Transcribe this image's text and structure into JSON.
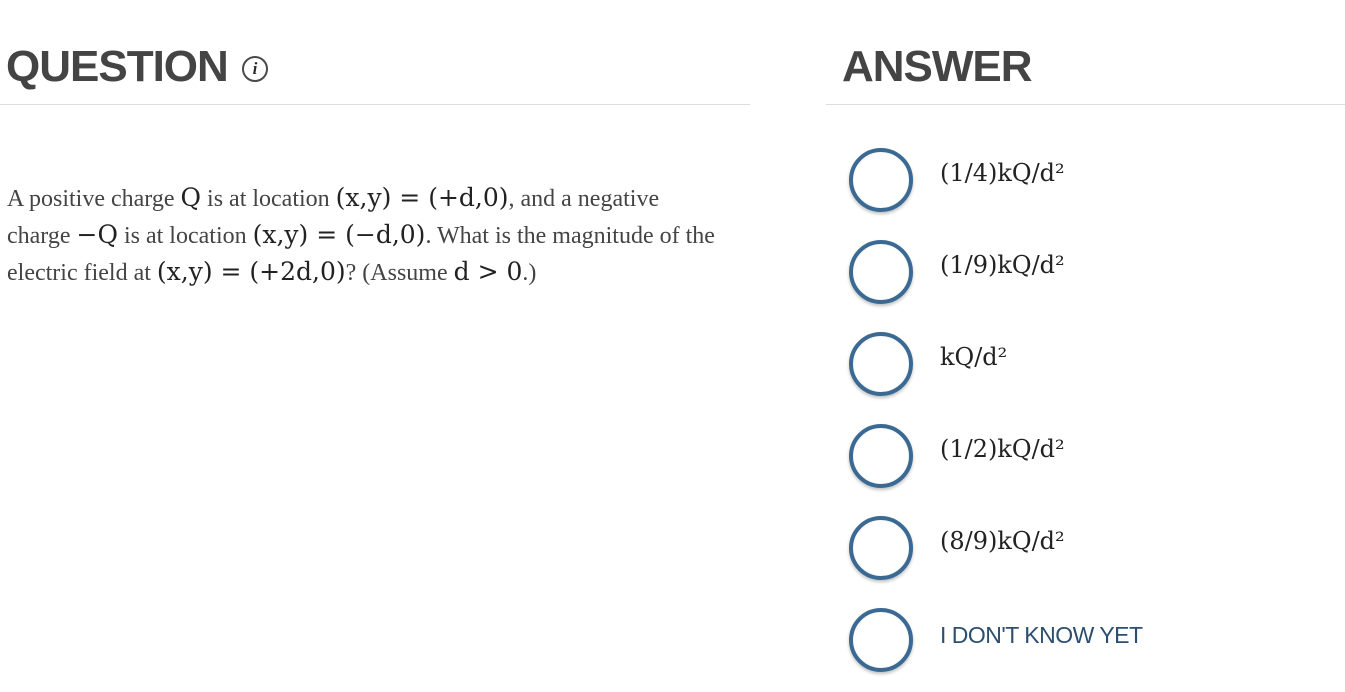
{
  "question": {
    "heading": "QUESTION",
    "info_icon": "info-icon",
    "text": [
      "A positive charge ",
      "Q",
      " is at location ",
      "(x,y) = (+d,0)",
      ", and a negative charge ",
      "−Q",
      " is at location ",
      "(x,y) = (−d,0)",
      ". What is the magnitude of the electric field at ",
      "(x,y) = (+2d,0)",
      "? (Assume ",
      "d > 0",
      ".)"
    ]
  },
  "answer": {
    "heading": "ANSWER",
    "choices": [
      {
        "label": "(1/4)kQ/d²"
      },
      {
        "label": "(1/9)kQ/d²"
      },
      {
        "label": "kQ/d²"
      },
      {
        "label": "(1/2)kQ/d²"
      },
      {
        "label": "(8/9)kQ/d²"
      },
      {
        "label": "I DON'T KNOW YET"
      }
    ]
  },
  "colors": {
    "radio_border": "#3a6a93",
    "heading_text": "#444444",
    "idk_text": "#2c4f70",
    "divider": "#dcdcdc"
  }
}
